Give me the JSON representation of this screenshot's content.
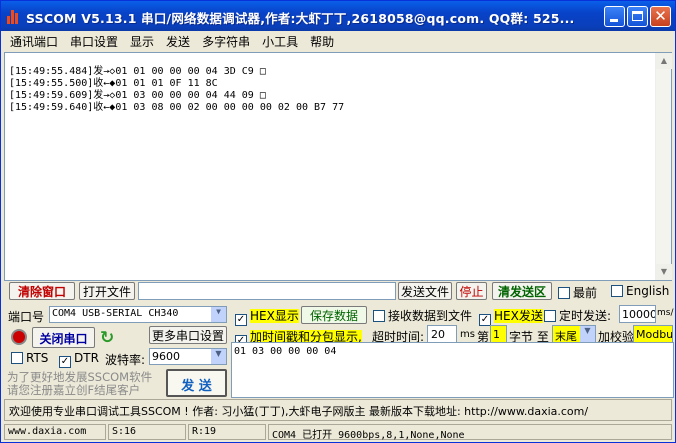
{
  "window": {
    "title": "SSCOM V5.13.1 串口/网络数据调试器,作者:大虾丁丁,2618058@qq.com. QQ群: 525..."
  },
  "menu": [
    "通讯端口",
    "串口设置",
    "显示",
    "发送",
    "多字符串",
    "小工具",
    "帮助"
  ],
  "receive_lines": [
    "[15:49:55.484]发→◇01 01 00 00 00 04 3D C9 □",
    "[15:49:55.500]收←◆01 01 01 0F 11 8C",
    "[15:49:59.609]发→◇01 03 00 00 00 04 44 09 □",
    "[15:49:59.640]收←◆01 03 08 00 02 00 00 00 00 02 00 B7 77"
  ],
  "toolbar": {
    "clear_window": "清除窗口",
    "open_file": "打开文件",
    "send_file": "发送文件",
    "stop": "停止",
    "clear_send": "清发送区",
    "top_most": "最前",
    "english": "English"
  },
  "port": {
    "label": "端口号",
    "value": "COM4 USB-SERIAL CH340",
    "close_button": "关闭串口",
    "more_settings": "更多串口设置",
    "rts": "RTS",
    "dtr": "DTR",
    "baud_label": "波特率:",
    "baud_value": "9600"
  },
  "options": {
    "hex_display": "HEX显示",
    "save_data": "保存数据",
    "recv_to_file": "接收数据到文件",
    "hex_send": "HEX发送",
    "timed_send": "定时发送:",
    "timed_value": "10000",
    "timed_unit": "ms/",
    "timestamp": "加时间戳和分包显示,",
    "timeout_label": "超时时间:",
    "timeout_value": "20",
    "timeout_unit": "ms",
    "byte_no": "第",
    "byte_value": "1",
    "byte_to": "字节 至",
    "end_value": "末尾",
    "checksum_label": "加校验",
    "checksum_value": "Modbus"
  },
  "send_text": "01 03 00 00 00 04",
  "send_button": "发 送",
  "promo": [
    "为了更好地发展SSCOM软件",
    "请您注册嘉立创F结尾客户"
  ],
  "status_line": "欢迎使用专业串口调试工具SSCOM ! 作者: 习小猛(丁丁),大虾电子网版主 最新版本下载地址: http://www.daxia.com/",
  "statusbar": {
    "site": "www.daxia.com",
    "sent": "S:16",
    "recv": "R:19",
    "port_state": "COM4 已打开  9600bps,8,1,None,None"
  },
  "colors": {
    "title_bar": "#0a4fd8",
    "highlight": "#ffff00",
    "accent_red": "#c00000"
  }
}
